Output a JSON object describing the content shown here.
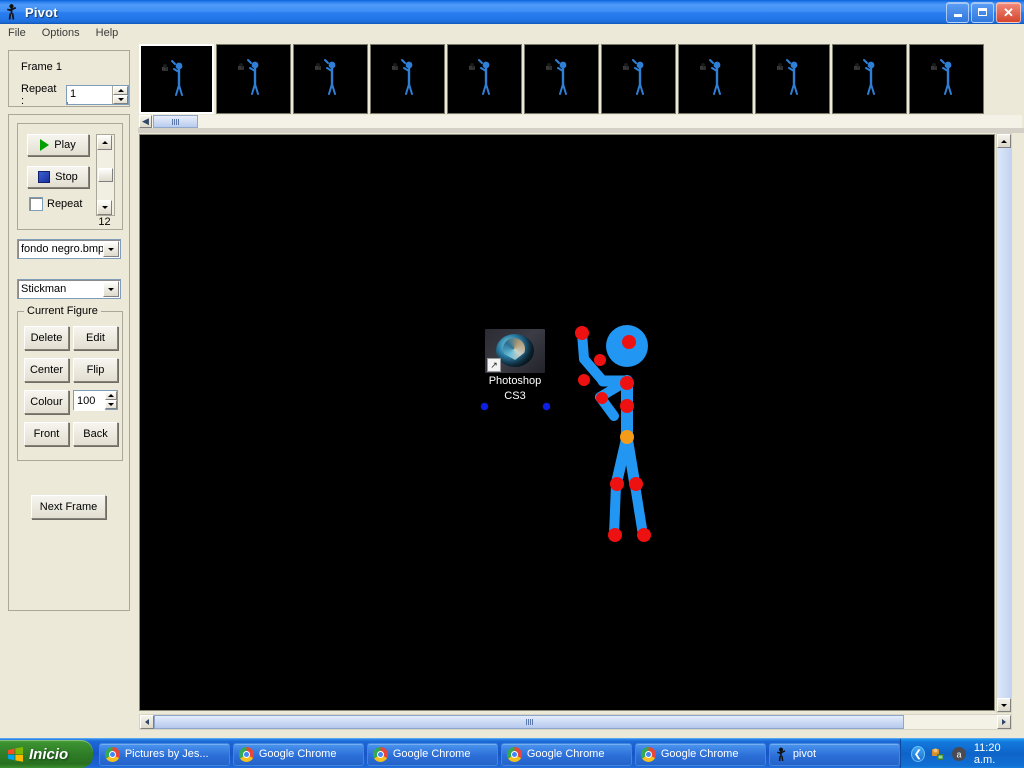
{
  "window": {
    "title": "Pivot",
    "icon": "stickman-icon",
    "buttons": {
      "minimize": "minimize-button",
      "maximize": "maximize-button",
      "close": "close-button"
    }
  },
  "menu": {
    "items": [
      {
        "label": "File"
      },
      {
        "label": "Options"
      },
      {
        "label": "Help"
      }
    ]
  },
  "sidebar": {
    "frame_group": {
      "frame_label": "Frame 1",
      "repeat_label": "Repeat :",
      "repeat_value": "1"
    },
    "playback": {
      "play_label": "Play",
      "stop_label": "Stop",
      "repeat_label": "Repeat",
      "repeat_checked": false,
      "speed_value": "12"
    },
    "background_combo": {
      "value": "fondo negro.bmp"
    },
    "figure_combo": {
      "value": "Stickman"
    },
    "current_figure": {
      "legend": "Current Figure",
      "buttons": [
        {
          "label": "Delete"
        },
        {
          "label": "Edit"
        },
        {
          "label": "Center"
        },
        {
          "label": "Flip"
        },
        {
          "label": "Colour"
        },
        {
          "label": "Front"
        },
        {
          "label": "Back"
        }
      ],
      "colour_value": "100"
    },
    "next_frame_label": "Next Frame"
  },
  "thumbnails": {
    "count": 11,
    "selected_index": 0,
    "scroll_left_label": "◀",
    "scroll_right_label": "▶"
  },
  "canvas": {
    "background_color": "#000000",
    "desktop_icon": {
      "label_line1": "Photoshop",
      "label_line2": "CS3",
      "name": "photoshop-cs3-icon"
    },
    "figure": {
      "name": "stickman",
      "limb_color": "#2196f3",
      "joint_color": "#ee1111",
      "hip_joint_color": "#f59b1a",
      "head_color": "#2196f3"
    },
    "scroll": {
      "up_label": "▲",
      "down_label": "▼",
      "left_label": "◀",
      "right_label": "▶"
    }
  },
  "taskbar": {
    "start_label": "Inicio",
    "tasks": [
      {
        "label": "Pictures by Jes...",
        "icon": "chrome-icon"
      },
      {
        "label": "Google Chrome",
        "icon": "chrome-icon"
      },
      {
        "label": "Google Chrome",
        "icon": "chrome-icon"
      },
      {
        "label": "Google Chrome",
        "icon": "chrome-icon"
      },
      {
        "label": "Google Chrome",
        "icon": "chrome-icon"
      },
      {
        "label": "pivot",
        "icon": "stickman-icon"
      }
    ],
    "tray": {
      "arrow": "❮",
      "clock": "11:20 a.m."
    }
  }
}
